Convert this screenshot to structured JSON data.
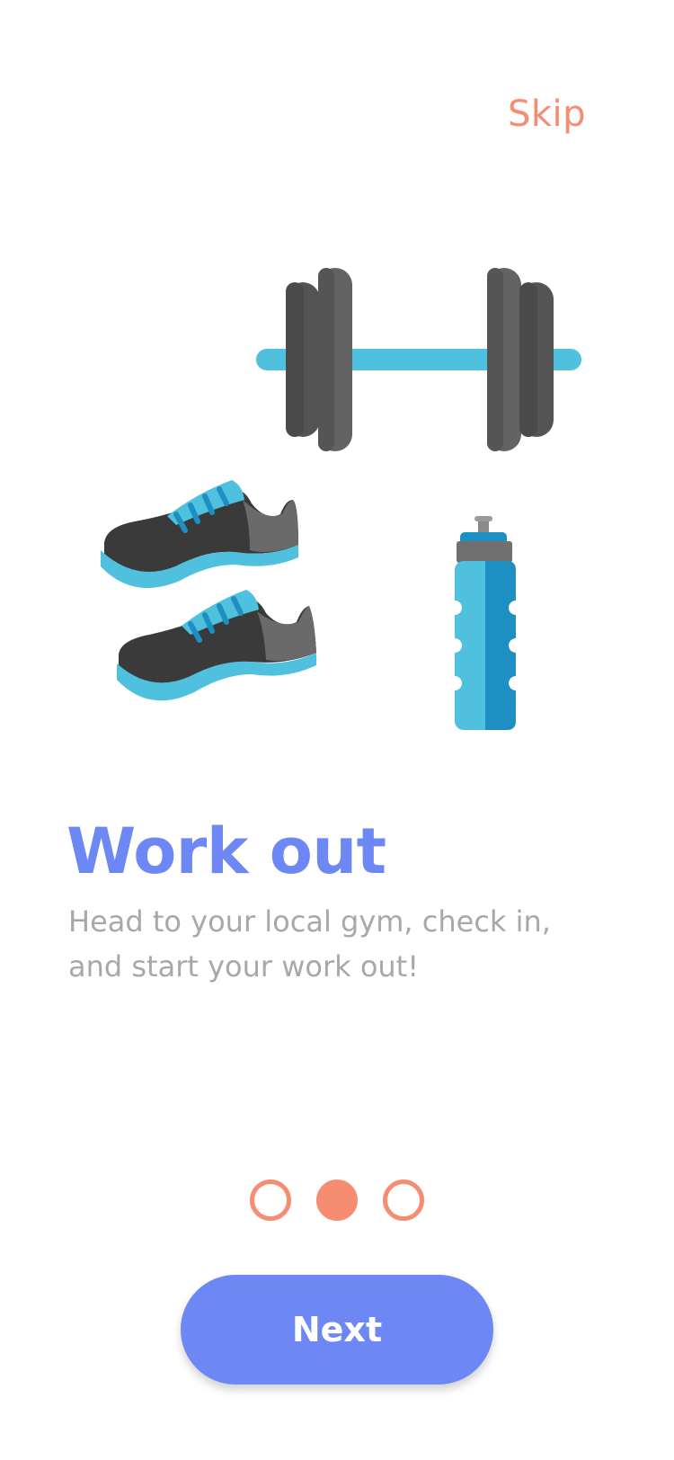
{
  "header": {
    "skip_label": "Skip"
  },
  "illustration": {
    "items": [
      "dumbbell-icon",
      "sneakers-icon",
      "water-bottle-icon"
    ]
  },
  "content": {
    "title": "Work out",
    "description": "Head to your local gym, check in, and start your work out!"
  },
  "pagination": {
    "total": 3,
    "active_index": 1
  },
  "footer": {
    "next_label": "Next"
  },
  "colors": {
    "accent": "#F68C71",
    "primary": "#6D87F4",
    "text_muted": "#A8A8A8"
  }
}
